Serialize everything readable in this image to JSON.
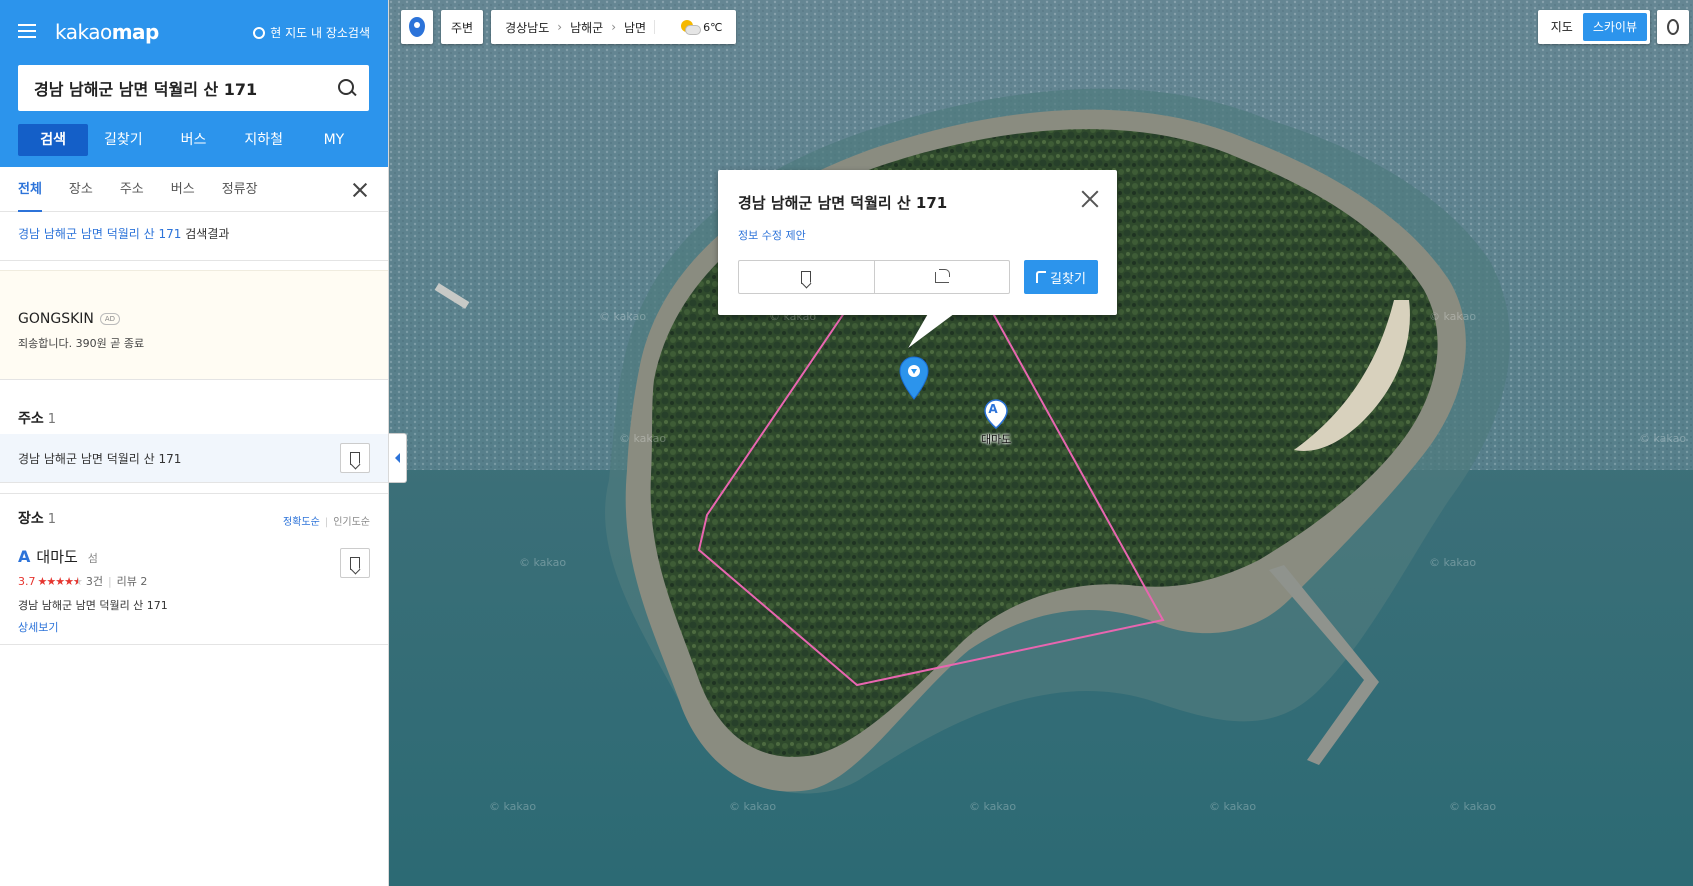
{
  "app": {
    "logo_light": "kakao",
    "logo_bold": "map",
    "map_search_toggle": "현 지도 내 장소검색"
  },
  "search": {
    "query": "경남 남해군 남면 덕월리 산 171"
  },
  "main_tabs": [
    "검색",
    "길찾기",
    "버스",
    "지하철",
    "MY"
  ],
  "sub_tabs": [
    "전체",
    "장소",
    "주소",
    "버스",
    "정류장"
  ],
  "result_summary": {
    "query": "경남 남해군 남면 덕월리 산 171",
    "suffix": "검색결과"
  },
  "ad": {
    "title": "GONGSKIN",
    "badge": "AD",
    "desc": "죄송합니다. 390원 곧 종료"
  },
  "address_section": {
    "title": "주소",
    "count": "1",
    "items": [
      "경남 남해군 남면 덕월리 산 171"
    ]
  },
  "place_section": {
    "title": "장소",
    "count": "1",
    "sort_accuracy": "정확도순",
    "sort_popular": "인기도순",
    "items": [
      {
        "marker": "A",
        "name": "대마도",
        "category": "섬",
        "score": "3.7",
        "rating": 3.7,
        "review_count_text": "3건",
        "reviews_text": "리뷰 2",
        "address": "경남 남해군 남면 덕월리 산 171",
        "detail_link": "상세보기"
      }
    ]
  },
  "map": {
    "nearby": "주변",
    "breadcrumb": [
      "경상남도",
      "남해군",
      "남면"
    ],
    "temperature": "6℃",
    "map_types": [
      "지도",
      "스카이뷰"
    ],
    "active_map_type": "스카이뷰",
    "watermark": "© kakao",
    "infowindow": {
      "title": "경남 남해군 남면 덕월리 산 171",
      "edit_link": "정보 수정 제안",
      "route_label": "길찾기"
    },
    "place_marker": {
      "letter": "A",
      "label": "대마도"
    }
  },
  "colors": {
    "brand_blue": "#2c94ec",
    "link_blue": "#2c73d9",
    "boundary_pink": "#e866b0",
    "rating_red": "#e6352f"
  }
}
